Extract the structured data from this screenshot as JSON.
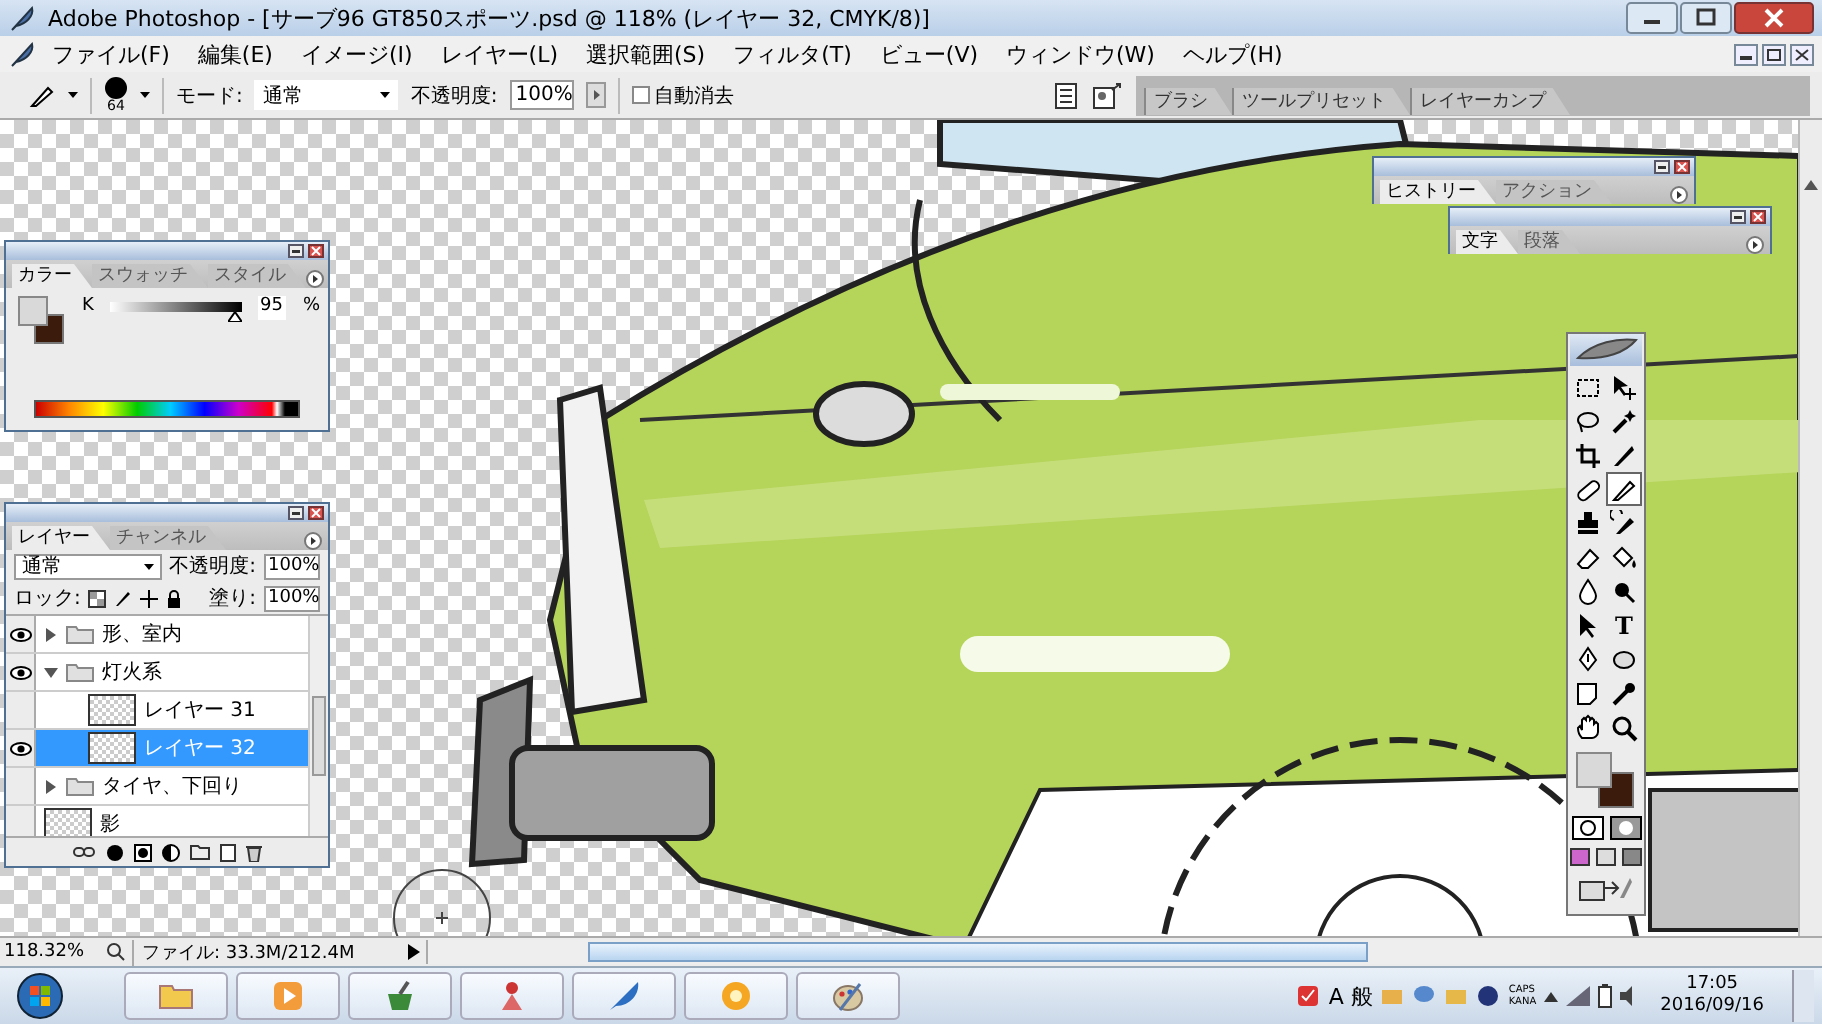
{
  "window": {
    "title": "Adobe Photoshop - [サーブ96 GT850スポーツ.psd @ 118% (レイヤー 32, CMYK/8)]"
  },
  "menu": [
    "ファイル(F)",
    "編集(E)",
    "イメージ(I)",
    "レイヤー(L)",
    "選択範囲(S)",
    "フィルタ(T)",
    "ビュー(V)",
    "ウィンドウ(W)",
    "ヘルプ(H)"
  ],
  "options_bar": {
    "brush_size": "64",
    "mode_label": "モード:",
    "mode": "通常",
    "opacity_label": "不透明度:",
    "opacity": "100%",
    "auto_erase": {
      "label": "自動消去",
      "checked": false
    }
  },
  "palette_well": {
    "tabs": [
      "ブラシ",
      "ツールプリセット",
      "レイヤーカンプ"
    ]
  },
  "panels": {
    "history": {
      "tabs": [
        {
          "label": "ヒストリー",
          "selected": true
        },
        {
          "label": "アクション",
          "selected": false
        }
      ]
    },
    "character": {
      "tabs": [
        {
          "label": "文字",
          "selected": true
        },
        {
          "label": "段落",
          "selected": false
        }
      ]
    },
    "color": {
      "tabs": [
        {
          "label": "カラー",
          "selected": true
        },
        {
          "label": "スウォッチ",
          "selected": false
        },
        {
          "label": "スタイル",
          "selected": false
        }
      ],
      "channel": "K",
      "level": 0.95,
      "value": "95",
      "unit": "%"
    },
    "layers": {
      "tabs": [
        {
          "label": "レイヤー",
          "selected": true
        },
        {
          "label": "チャンネル",
          "selected": false
        }
      ],
      "blend_mode": "通常",
      "opacity_label": "不透明度:",
      "opacity": "100%",
      "lock_label": "ロック:",
      "fill_label": "塗り:",
      "fill": "100%",
      "items": [
        {
          "kind": "group",
          "name": "形、室内",
          "visible": true,
          "expanded": false,
          "selected": false
        },
        {
          "kind": "group",
          "name": "灯火系",
          "visible": true,
          "expanded": true,
          "selected": false,
          "children": [
            {
              "kind": "layer",
              "name": "レイヤー 31",
              "visible": false,
              "selected": false
            },
            {
              "kind": "layer",
              "name": "レイヤー 32",
              "visible": true,
              "selected": true
            }
          ]
        },
        {
          "kind": "group",
          "name": "タイヤ、下回り",
          "visible": false,
          "expanded": false,
          "selected": false
        },
        {
          "kind": "layer",
          "name": "影",
          "visible": false,
          "selected": false
        }
      ]
    }
  },
  "tools": [
    {
      "kind": "marquee",
      "selected": false
    },
    {
      "kind": "move",
      "selected": false
    },
    {
      "kind": "lasso",
      "selected": false
    },
    {
      "kind": "wand",
      "selected": false
    },
    {
      "kind": "crop",
      "selected": false
    },
    {
      "kind": "slice",
      "selected": false
    },
    {
      "kind": "heal",
      "selected": false
    },
    {
      "kind": "brush",
      "selected": true
    },
    {
      "kind": "stamp",
      "selected": false
    },
    {
      "kind": "history",
      "selected": false
    },
    {
      "kind": "eraser",
      "selected": false
    },
    {
      "kind": "bucket",
      "selected": false
    },
    {
      "kind": "blur",
      "selected": false
    },
    {
      "kind": "dodge",
      "selected": false
    },
    {
      "kind": "select",
      "selected": false
    },
    {
      "kind": "type",
      "label": "T",
      "selected": false
    },
    {
      "kind": "pen",
      "selected": false
    },
    {
      "kind": "ellipse",
      "selected": false
    },
    {
      "kind": "notes",
      "selected": false
    },
    {
      "kind": "eyedropper",
      "selected": false
    },
    {
      "kind": "hand",
      "selected": false
    },
    {
      "kind": "zoom",
      "selected": false
    }
  ],
  "status_bar": {
    "zoom": "118.32%",
    "file_info": "ファイル: 33.3M/212.4M"
  },
  "taskbar": {
    "ime": "A 般",
    "caps": "CAPS",
    "kana": "KANA",
    "time": "17:05",
    "date": "2016/09/16"
  }
}
